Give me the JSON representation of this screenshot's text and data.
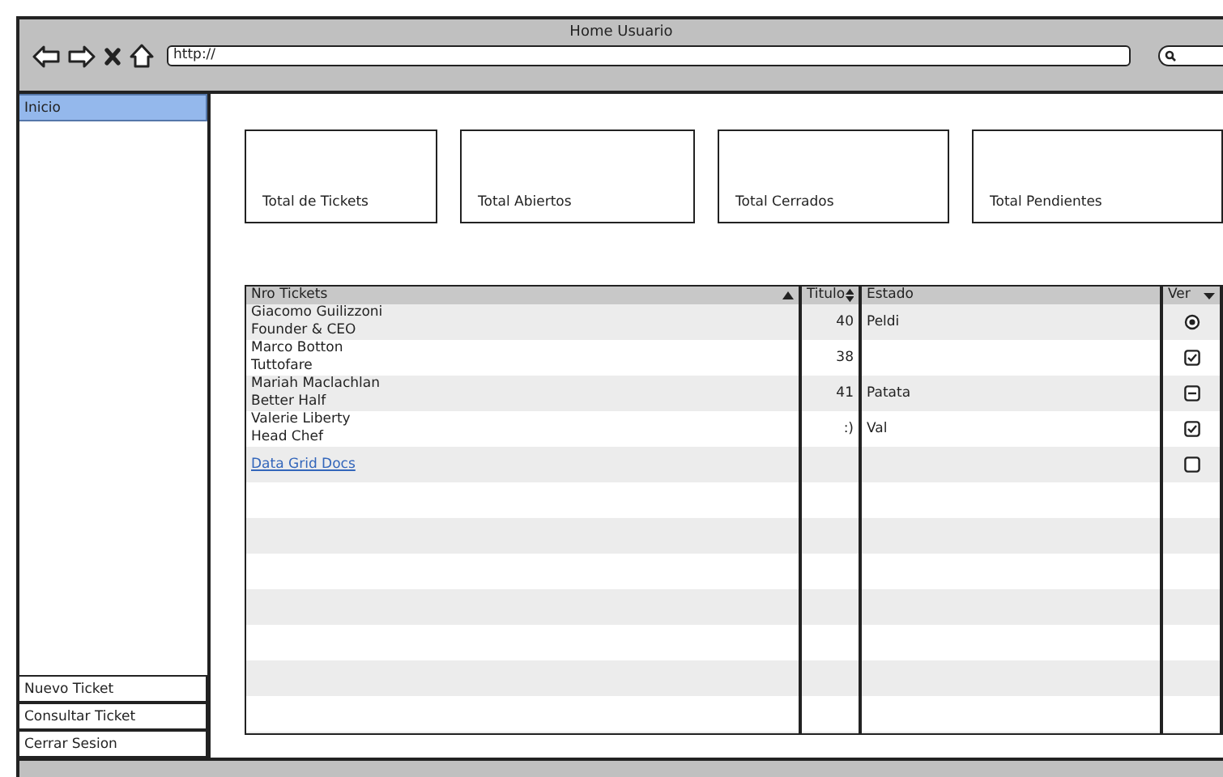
{
  "window": {
    "title": "Home Usuario"
  },
  "address_bar": {
    "value": "http://"
  },
  "sidebar": {
    "items": [
      {
        "label": "Inicio",
        "selected": true
      }
    ],
    "bottom_items": [
      {
        "label": "Nuevo Ticket",
        "selected": false
      },
      {
        "label": "Consultar Ticket",
        "selected": false
      },
      {
        "label": "Cerrar Sesion",
        "selected": false
      }
    ]
  },
  "cards": [
    {
      "label": "Total de Tickets"
    },
    {
      "label": "Total Abiertos"
    },
    {
      "label": "Total Cerrados"
    },
    {
      "label": "Total Pendientes"
    }
  ],
  "table": {
    "columns": [
      "Nro Tickets",
      "Titulo",
      "Estado",
      "Ver"
    ],
    "rows": [
      {
        "kind": "text",
        "lines": [
          "Giacomo Guilizzoni",
          "Founder & CEO"
        ],
        "titulo": "40",
        "estado": "Peldi",
        "ver": {
          "kind": "radio",
          "checked": true
        }
      },
      {
        "kind": "text",
        "lines": [
          "Marco Botton",
          "Tuttofare"
        ],
        "titulo": "38",
        "ver": {
          "kind": "checkbox",
          "checked": true,
          "mixed": false
        }
      },
      {
        "kind": "text",
        "lines": [
          "Mariah Maclachlan",
          "Better Half"
        ],
        "titulo": "41",
        "estado": "Patata",
        "ver": {
          "kind": "checkbox",
          "checked": false,
          "mixed": true
        }
      },
      {
        "kind": "text",
        "lines": [
          "Valerie Liberty",
          "Head Chef"
        ],
        "titulo": ":)",
        "estado": "Val",
        "ver": {
          "kind": "checkbox",
          "checked": true,
          "mixed": false
        }
      },
      {
        "kind": "link",
        "lines": [
          "Data Grid Docs"
        ],
        "ver": {
          "kind": "checkbox",
          "checked": false,
          "mixed": false
        }
      }
    ]
  }
}
